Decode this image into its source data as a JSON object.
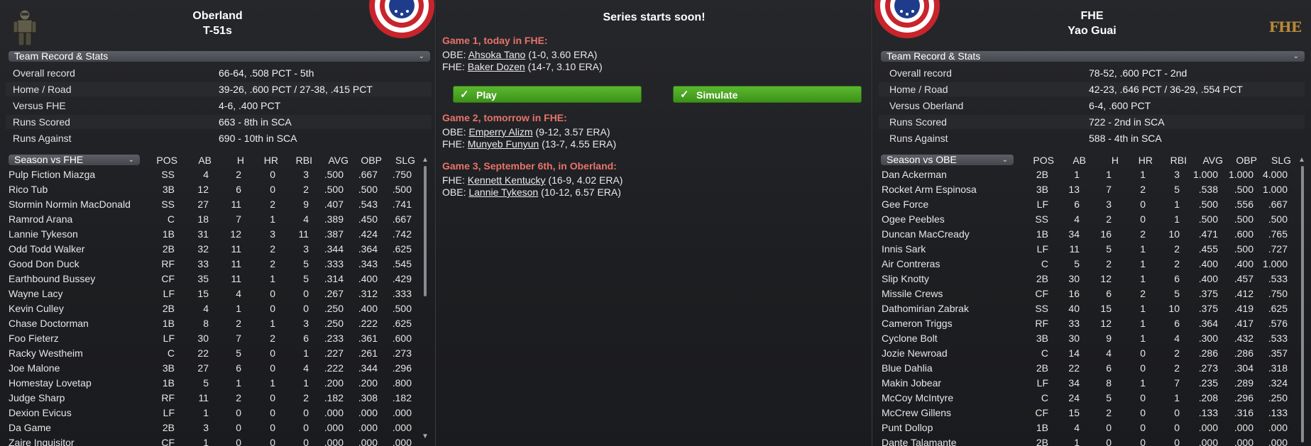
{
  "left": {
    "team_name": "Oberland",
    "team_sub": "T-51s",
    "section_label": "Team Record & Stats",
    "stats": [
      {
        "label": "Overall record",
        "value": "66-64, .508 PCT - 5th"
      },
      {
        "label": "Home / Road",
        "value": "39-26, .600 PCT / 27-38, .415 PCT"
      },
      {
        "label": "Versus FHE",
        "value": "4-6, .400 PCT"
      },
      {
        "label": "Runs Scored",
        "value": "663 - 8th in SCA"
      },
      {
        "label": "Runs Against",
        "value": "690 - 10th in SCA"
      }
    ],
    "roster_select": "Season vs FHE",
    "headers": {
      "pos": "POS",
      "ab": "AB",
      "h": "H",
      "hr": "HR",
      "rbi": "RBI",
      "avg": "AVG",
      "obp": "OBP",
      "slg": "SLG"
    },
    "players": [
      [
        "Pulp Fiction Miazga",
        "SS",
        "4",
        "2",
        "0",
        "3",
        ".500",
        ".667",
        ".750"
      ],
      [
        "Rico Tub",
        "3B",
        "12",
        "6",
        "0",
        "2",
        ".500",
        ".500",
        ".500"
      ],
      [
        "Stormin Normin MacDonald",
        "SS",
        "27",
        "11",
        "2",
        "9",
        ".407",
        ".543",
        ".741"
      ],
      [
        "Ramrod Arana",
        "C",
        "18",
        "7",
        "1",
        "4",
        ".389",
        ".450",
        ".667"
      ],
      [
        "Lannie Tykeson",
        "1B",
        "31",
        "12",
        "3",
        "11",
        ".387",
        ".424",
        ".742"
      ],
      [
        "Odd Todd Walker",
        "2B",
        "32",
        "11",
        "2",
        "3",
        ".344",
        ".364",
        ".625"
      ],
      [
        "Good Don Duck",
        "RF",
        "33",
        "11",
        "2",
        "5",
        ".333",
        ".343",
        ".545"
      ],
      [
        "Earthbound Bussey",
        "CF",
        "35",
        "11",
        "1",
        "5",
        ".314",
        ".400",
        ".429"
      ],
      [
        "Wayne Lacy",
        "LF",
        "15",
        "4",
        "0",
        "0",
        ".267",
        ".312",
        ".333"
      ],
      [
        "Kevin Culley",
        "2B",
        "4",
        "1",
        "0",
        "0",
        ".250",
        ".400",
        ".500"
      ],
      [
        "Chase Doctorman",
        "1B",
        "8",
        "2",
        "1",
        "3",
        ".250",
        ".222",
        ".625"
      ],
      [
        "Foo Fieterz",
        "LF",
        "30",
        "7",
        "2",
        "6",
        ".233",
        ".361",
        ".600"
      ],
      [
        "Racky Westheim",
        "C",
        "22",
        "5",
        "0",
        "1",
        ".227",
        ".261",
        ".273"
      ],
      [
        "Joe Malone",
        "3B",
        "27",
        "6",
        "0",
        "4",
        ".222",
        ".344",
        ".296"
      ],
      [
        "Homestay Lovetap",
        "1B",
        "5",
        "1",
        "1",
        "1",
        ".200",
        ".200",
        ".800"
      ],
      [
        "Judge Sharp",
        "RF",
        "11",
        "2",
        "0",
        "2",
        ".182",
        ".308",
        ".182"
      ],
      [
        "Dexion Evicus",
        "LF",
        "1",
        "0",
        "0",
        "0",
        ".000",
        ".000",
        ".000"
      ],
      [
        "Da Game",
        "2B",
        "3",
        "0",
        "0",
        "0",
        ".000",
        ".000",
        ".000"
      ],
      [
        "Zaire Inquisitor",
        "CF",
        "1",
        "0",
        "0",
        "0",
        ".000",
        ".000",
        ".000"
      ]
    ]
  },
  "center": {
    "title": "Series starts soon!",
    "games": [
      {
        "head": "Game 1, today in FHE:",
        "lines": [
          {
            "team": "OBE:",
            "pitcher": "Ahsoka Tano",
            "rec": "(1-0, 3.60 ERA)"
          },
          {
            "team": "FHE:",
            "pitcher": "Baker Dozen",
            "rec": "(14-7, 3.10 ERA)"
          }
        ]
      },
      {
        "head": "Game 2, tomorrow in FHE:",
        "lines": [
          {
            "team": "OBE:",
            "pitcher": "Emperry Alizm",
            "rec": "(9-12, 3.57 ERA)"
          },
          {
            "team": "FHE:",
            "pitcher": "Munyeb Funyun",
            "rec": "(13-7, 4.55 ERA)"
          }
        ]
      },
      {
        "head": "Game 3, September 6th,  in Oberland:",
        "lines": [
          {
            "team": "FHE:",
            "pitcher": "Kennett Kentucky",
            "rec": "(16-9, 4.02 ERA)"
          },
          {
            "team": "OBE:",
            "pitcher": "Lannie Tykeson",
            "rec": "(10-12, 6.57 ERA)"
          }
        ]
      }
    ],
    "play_label": "Play",
    "simulate_label": "Simulate"
  },
  "right": {
    "team_name": "FHE",
    "team_sub": "Yao Guai",
    "logo_text": "FHE",
    "section_label": "Team Record & Stats",
    "stats": [
      {
        "label": "Overall record",
        "value": "78-52, .600 PCT - 2nd"
      },
      {
        "label": "Home / Road",
        "value": "42-23, .646 PCT / 36-29, .554 PCT"
      },
      {
        "label": "Versus Oberland",
        "value": "6-4, .600 PCT"
      },
      {
        "label": "Runs Scored",
        "value": "722 - 2nd in SCA"
      },
      {
        "label": "Runs Against",
        "value": "588 - 4th in SCA"
      }
    ],
    "roster_select": "Season vs OBE",
    "headers": {
      "pos": "POS",
      "ab": "AB",
      "h": "H",
      "hr": "HR",
      "rbi": "RBI",
      "avg": "AVG",
      "obp": "OBP",
      "slg": "SLG"
    },
    "players": [
      [
        "Dan Ackerman",
        "2B",
        "1",
        "1",
        "1",
        "3",
        "1.000",
        "1.000",
        "4.000"
      ],
      [
        "Rocket Arm Espinosa",
        "3B",
        "13",
        "7",
        "2",
        "5",
        ".538",
        ".500",
        "1.000"
      ],
      [
        "Gee Force",
        "LF",
        "6",
        "3",
        "0",
        "1",
        ".500",
        ".556",
        ".667"
      ],
      [
        "Ogee Peebles",
        "SS",
        "4",
        "2",
        "0",
        "1",
        ".500",
        ".500",
        ".500"
      ],
      [
        "Duncan MacCready",
        "1B",
        "34",
        "16",
        "2",
        "10",
        ".471",
        ".600",
        ".765"
      ],
      [
        "Innis Sark",
        "LF",
        "11",
        "5",
        "1",
        "2",
        ".455",
        ".500",
        ".727"
      ],
      [
        "Air Contreras",
        "C",
        "5",
        "2",
        "1",
        "2",
        ".400",
        ".400",
        "1.000"
      ],
      [
        "Slip Knotty",
        "2B",
        "30",
        "12",
        "1",
        "6",
        ".400",
        ".457",
        ".533"
      ],
      [
        "Missile Crews",
        "CF",
        "16",
        "6",
        "2",
        "5",
        ".375",
        ".412",
        ".750"
      ],
      [
        "Dathomirian Zabrak",
        "SS",
        "40",
        "15",
        "1",
        "10",
        ".375",
        ".419",
        ".625"
      ],
      [
        "Cameron Triggs",
        "RF",
        "33",
        "12",
        "1",
        "6",
        ".364",
        ".417",
        ".576"
      ],
      [
        "Cyclone Bolt",
        "3B",
        "30",
        "9",
        "1",
        "4",
        ".300",
        ".432",
        ".533"
      ],
      [
        "Jozie Newroad",
        "C",
        "14",
        "4",
        "0",
        "2",
        ".286",
        ".286",
        ".357"
      ],
      [
        "Blue Dahlia",
        "2B",
        "22",
        "6",
        "0",
        "2",
        ".273",
        ".304",
        ".318"
      ],
      [
        "Makin Jobear",
        "LF",
        "34",
        "8",
        "1",
        "7",
        ".235",
        ".289",
        ".324"
      ],
      [
        "McCoy McIntyre",
        "C",
        "24",
        "5",
        "0",
        "1",
        ".208",
        ".296",
        ".250"
      ],
      [
        "McCrew Gillens",
        "CF",
        "15",
        "2",
        "0",
        "0",
        ".133",
        ".316",
        ".133"
      ],
      [
        "Punt Dollop",
        "1B",
        "4",
        "0",
        "0",
        "0",
        ".000",
        ".000",
        ".000"
      ],
      [
        "Dante Talamante",
        "2B",
        "1",
        "0",
        "0",
        "0",
        ".000",
        ".000",
        ".000"
      ]
    ]
  }
}
